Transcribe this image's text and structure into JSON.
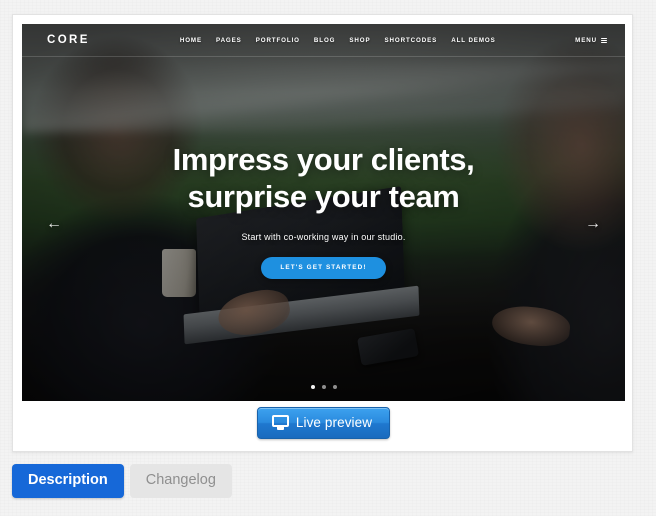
{
  "preview": {
    "hero": {
      "logo": "CORE",
      "menu_items": [
        {
          "label": "HOME"
        },
        {
          "label": "PAGES"
        },
        {
          "label": "PORTFOLIO"
        },
        {
          "label": "BLOG"
        },
        {
          "label": "SHOP"
        },
        {
          "label": "SHORTCODES"
        },
        {
          "label": "ALL DEMOS"
        }
      ],
      "menu_toggle_label": "MENU",
      "menu_toggle_icon": "hamburger-icon",
      "title_line1": "Impress your clients,",
      "title_line2": "surprise your team",
      "subtitle": "Start with co-working way in our studio.",
      "cta_label": "LET'S GET STARTED!",
      "cta_color": "#1e90e0",
      "prev_arrow_icon": "arrow-left-icon",
      "prev_arrow_glyph": "←",
      "next_arrow_icon": "arrow-right-icon",
      "next_arrow_glyph": "→",
      "slide_count": 3,
      "active_slide": 1
    },
    "live_preview": {
      "label": "Live preview",
      "icon": "monitor-icon",
      "color": "#2a8ade"
    }
  },
  "tabs": [
    {
      "label": "Description",
      "active": true,
      "color": "#1668d8"
    },
    {
      "label": "Changelog",
      "active": false,
      "color": "#e5e5e5"
    }
  ]
}
